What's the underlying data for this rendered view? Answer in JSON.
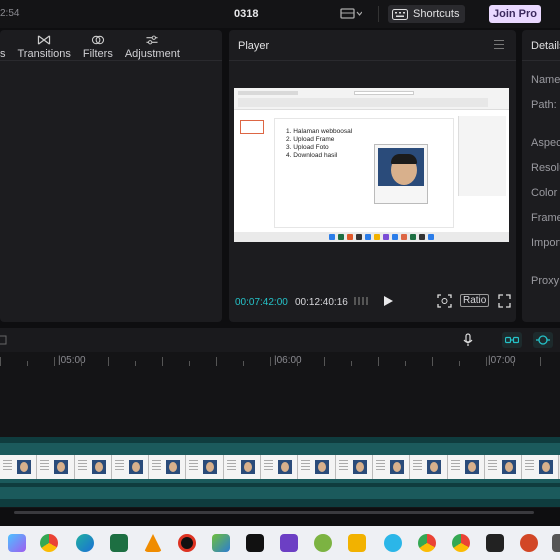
{
  "topbar": {
    "clock": "2:54",
    "project_name": "0318",
    "shortcuts_label": "Shortcuts",
    "join_pro_label": "Join Pro"
  },
  "left_panel": {
    "tabs": [
      {
        "label": "s",
        "icon": "partial-icon"
      },
      {
        "label": "Transitions",
        "icon": "bowtie-icon"
      },
      {
        "label": "Filters",
        "icon": "filter-icon"
      },
      {
        "label": "Adjustment",
        "icon": "sliders-icon"
      }
    ]
  },
  "player": {
    "title": "Player",
    "preview": {
      "list": [
        "1.  Halaman webboosal",
        "2.  Upload Frame",
        "3.  Upload Foto",
        "4.  Download hasil"
      ]
    },
    "timecode_current": "00:07:42:00",
    "timecode_total": "00:12:40:16",
    "ratio_label": "Ratio"
  },
  "details": {
    "title": "Details",
    "labels": [
      "Name:",
      "Path:",
      "Aspect",
      "Resolu",
      "Color s",
      "Frame",
      "Import",
      "Proxy:"
    ]
  },
  "timeline": {
    "ruler_labels": [
      "|05:00",
      "|06:00",
      "|07:00"
    ]
  },
  "colors": {
    "accent": "#25c2c8",
    "pro_badge": "#e9d8ff",
    "track": "#1b5a5c"
  }
}
